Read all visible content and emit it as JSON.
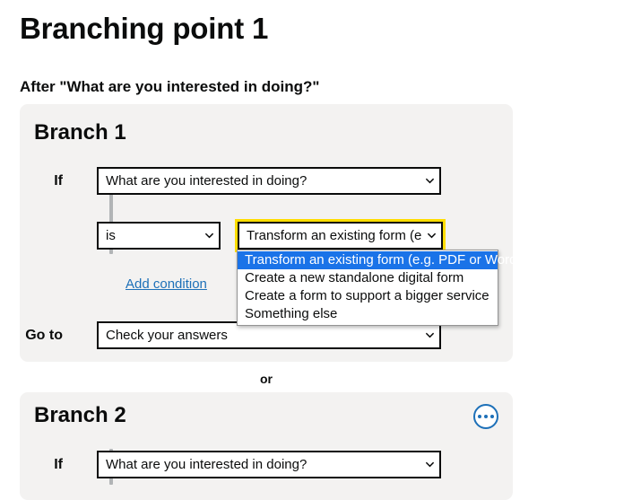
{
  "page": {
    "title": "Branching point 1",
    "subtitle": "After \"What are you interested in doing?\""
  },
  "separator": {
    "label": "or"
  },
  "branches": [
    {
      "title": "Branch 1",
      "if_label": "If",
      "question_select": {
        "value": "What are you interested in doing?",
        "chevron_icon": "chevron-down-icon"
      },
      "operator_select": {
        "value": "is",
        "chevron_icon": "chevron-down-icon"
      },
      "answer_select": {
        "value": "Transform an existing form (e.g. PDF or Word)",
        "display_value": "Transform an existing form (e.g. F",
        "chevron_icon": "chevron-down-icon",
        "focused": true,
        "expanded": true,
        "options": [
          "Transform an existing form (e.g. PDF or Word)",
          "Create a new standalone digital form",
          "Create a form to support a bigger service",
          "Something else"
        ],
        "selected_index": 0
      },
      "add_condition_link": "Add condition",
      "goto_label": "Go to",
      "goto_select": {
        "value": "Check your answers",
        "chevron_icon": "chevron-down-icon"
      }
    },
    {
      "title": "Branch 2",
      "more_options_icon": "ellipsis-icon",
      "if_label": "If",
      "question_select": {
        "value": "What are you interested in doing?",
        "chevron_icon": "chevron-down-icon"
      }
    }
  ],
  "colors": {
    "panel_background": "#f3f2f1",
    "page_background": "#ffffff",
    "text": "#0b0c0c",
    "link": "#1d70b8",
    "focus_ring": "#ffdd00",
    "option_highlight": "#1a73e8",
    "rule": "#b1b4b6",
    "more_button_border": "#1d70b8"
  }
}
